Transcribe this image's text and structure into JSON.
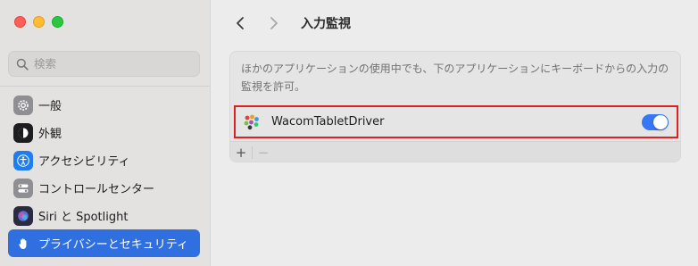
{
  "window": {
    "traffic_lights": [
      "close",
      "minimize",
      "zoom"
    ]
  },
  "sidebar": {
    "search_placeholder": "検索",
    "items": [
      {
        "label": "一般",
        "icon": "gear-icon",
        "color": "#8e8e93",
        "active": false
      },
      {
        "label": "外観",
        "icon": "appearance-icon",
        "color": "#1d1d1f",
        "active": false
      },
      {
        "label": "アクセシビリティ",
        "icon": "accessibility-icon",
        "color": "#1e7ef0",
        "active": false
      },
      {
        "label": "コントロールセンター",
        "icon": "control-center-icon",
        "color": "#8e8e93",
        "active": false
      },
      {
        "label": "Siri と Spotlight",
        "icon": "siri-icon",
        "color": "#3a3a5a",
        "active": false
      },
      {
        "label": "プライバシーとセキュリティ",
        "icon": "hand-icon",
        "color": "#2f6fe0",
        "active": true
      }
    ]
  },
  "header": {
    "title": "入力監視"
  },
  "panel": {
    "description": "ほかのアプリケーションの使用中でも、下のアプリケーションにキーボードからの入力の監視を許可。",
    "apps": [
      {
        "name": "WacomTabletDriver",
        "enabled": true,
        "icon": "wacom-icon"
      }
    ],
    "add_label": "+",
    "remove_label": "−"
  },
  "colors": {
    "accent": "#3478f6",
    "highlight_box": "#e02020"
  }
}
